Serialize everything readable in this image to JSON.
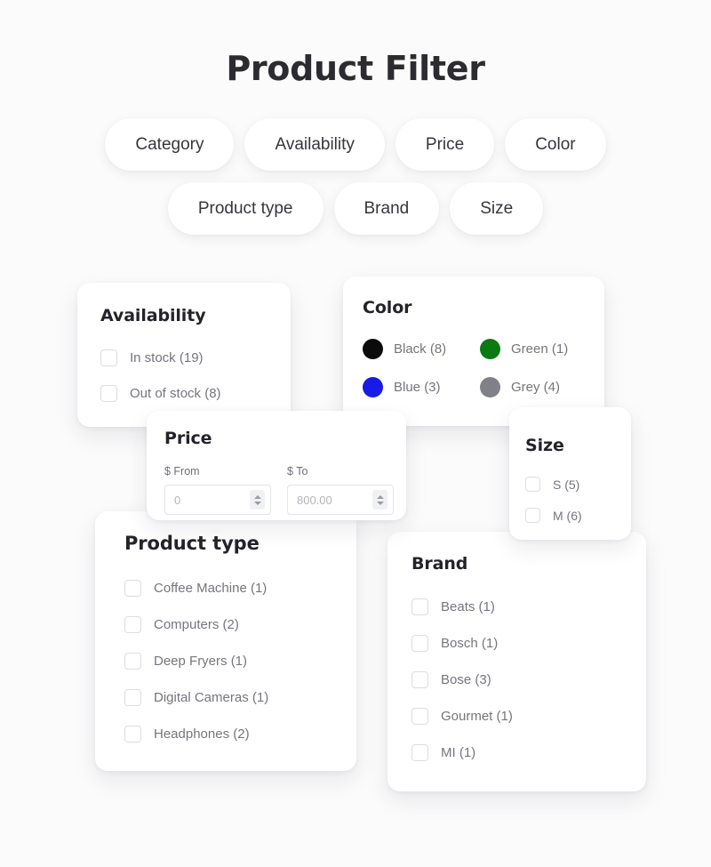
{
  "page": {
    "title": "Product Filter"
  },
  "filter_pills": {
    "row1": [
      {
        "label": "Category"
      },
      {
        "label": "Availability"
      },
      {
        "label": "Price"
      },
      {
        "label": "Color"
      }
    ],
    "row2": [
      {
        "label": "Product type"
      },
      {
        "label": "Brand"
      },
      {
        "label": "Size"
      }
    ]
  },
  "cards": {
    "availability": {
      "title": "Availability",
      "options": [
        {
          "label": "In stock (19)",
          "checked": false
        },
        {
          "label": "Out of stock (8)",
          "checked": false
        }
      ]
    },
    "color": {
      "title": "Color",
      "options": [
        {
          "label": "Black (8)",
          "swatch": "#0b0b0b",
          "icon": "color-swatch-black"
        },
        {
          "label": "Green (1)",
          "swatch": "#0a7a11",
          "icon": "color-swatch-green"
        },
        {
          "label": "Blue (3)",
          "swatch": "#1a1ae6",
          "icon": "color-swatch-blue"
        },
        {
          "label": "Grey (4)",
          "swatch": "#808089",
          "icon": "color-swatch-grey"
        }
      ]
    },
    "price": {
      "title": "Price",
      "from": {
        "label": "$ From",
        "value": "0",
        "placeholder": "0"
      },
      "to": {
        "label": "$ To",
        "value": "800.00",
        "placeholder": "800.00"
      },
      "spinner_icon": "stepper-updown-icon"
    },
    "size": {
      "title": "Size",
      "options": [
        {
          "label": "S (5)",
          "checked": false
        },
        {
          "label": "M (6)",
          "checked": false
        }
      ]
    },
    "product_type": {
      "title": "Product type",
      "options": [
        {
          "label": "Coffee Machine (1)",
          "checked": false
        },
        {
          "label": "Computers (2)",
          "checked": false
        },
        {
          "label": "Deep Fryers (1)",
          "checked": false
        },
        {
          "label": "Digital Cameras (1)",
          "checked": false
        },
        {
          "label": "Headphones (2)",
          "checked": false
        }
      ]
    },
    "brand": {
      "title": "Brand",
      "options": [
        {
          "label": "Beats (1)",
          "checked": false
        },
        {
          "label": "Bosch (1)",
          "checked": false
        },
        {
          "label": "Bose (3)",
          "checked": false
        },
        {
          "label": "Gourmet (1)",
          "checked": false
        },
        {
          "label": "MI (1)",
          "checked": false
        }
      ]
    }
  },
  "theme": {
    "background": "#fbfbfb",
    "card_background": "#ffffff",
    "title_color": "#2c2c30",
    "label_color": "#75757f",
    "border_color": "#dcdde2"
  }
}
